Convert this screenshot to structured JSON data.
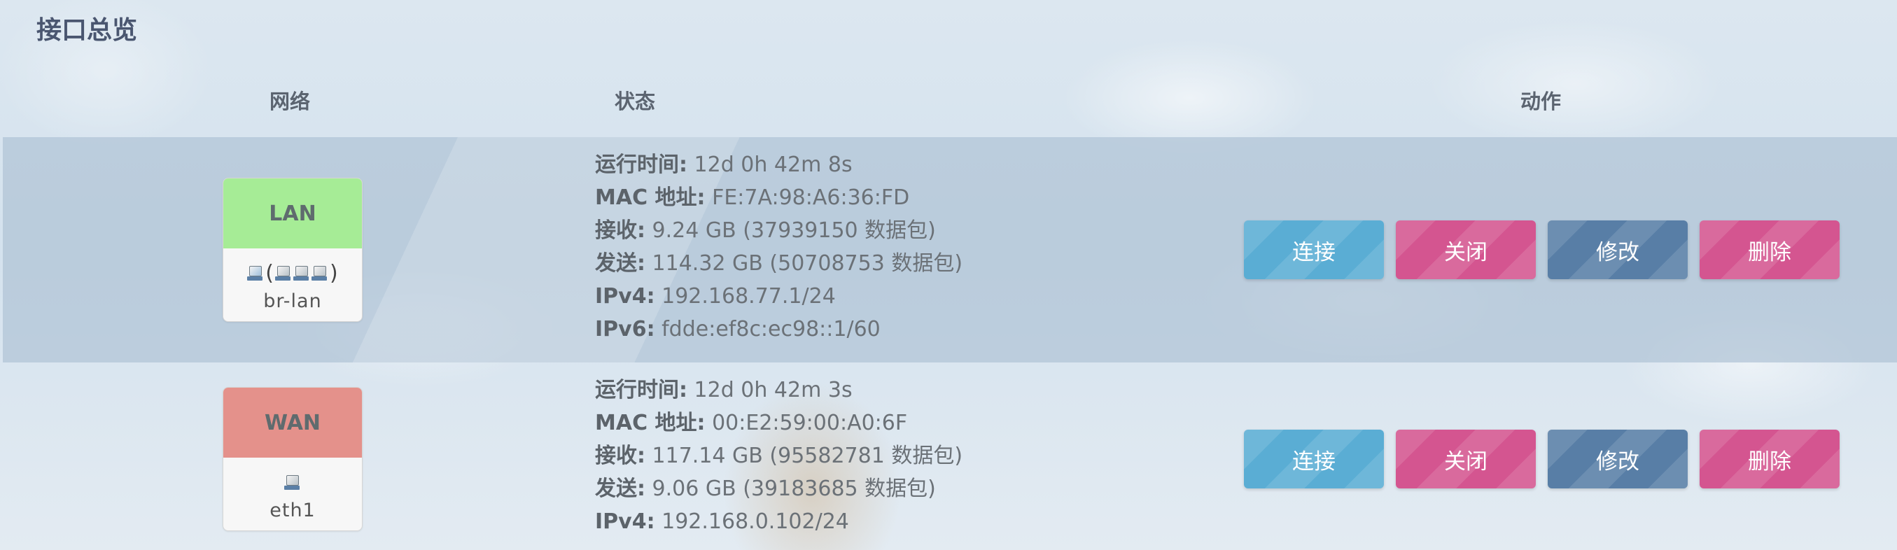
{
  "page": {
    "title": "接口总览"
  },
  "table": {
    "headers": {
      "network": "网络",
      "status": "状态",
      "actions": "动作"
    }
  },
  "colors": {
    "lan_badge": "#a6ec96",
    "wan_badge": "#e4918b",
    "connect_button": "#5aadd4",
    "close_button": "#d45590",
    "edit_button": "#587ea6",
    "delete_button": "#d45590"
  },
  "interfaces": [
    {
      "name": "LAN",
      "device_icons_open": "(",
      "device_icons_close": ")",
      "device": "br-lan",
      "status": [
        {
          "key": "运行时间:",
          "value": "12d 0h 42m 8s"
        },
        {
          "key": "MAC 地址:",
          "value": "FE:7A:98:A6:36:FD"
        },
        {
          "key": "接收:",
          "value": "9.24 GB (37939150 数据包)"
        },
        {
          "key": "发送:",
          "value": "114.32 GB (50708753 数据包)"
        },
        {
          "key": "IPv4:",
          "value": "192.168.77.1/24"
        },
        {
          "key": "IPv6:",
          "value": "fdde:ef8c:ec98::1/60"
        }
      ],
      "actions": {
        "connect": "连接",
        "close": "关闭",
        "edit": "修改",
        "delete": "删除"
      }
    },
    {
      "name": "WAN",
      "device": "eth1",
      "status": [
        {
          "key": "运行时间:",
          "value": "12d 0h 42m 3s"
        },
        {
          "key": "MAC 地址:",
          "value": "00:E2:59:00:A0:6F"
        },
        {
          "key": "接收:",
          "value": "117.14 GB (95582781 数据包)"
        },
        {
          "key": "发送:",
          "value": "9.06 GB (39183685 数据包)"
        },
        {
          "key": "IPv4:",
          "value": "192.168.0.102/24"
        }
      ],
      "actions": {
        "connect": "连接",
        "close": "关闭",
        "edit": "修改",
        "delete": "删除"
      }
    }
  ]
}
